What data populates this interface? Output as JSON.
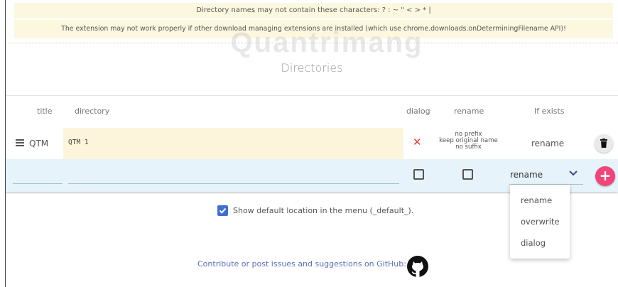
{
  "notices": {
    "line1": "Directory names may not contain these characters: ? : ~ \" < > * |",
    "line2": "The extension may not work properly if other download managing extensions are installed (which use chrome.downloads.onDeterminingFilename API)!"
  },
  "watermark": "Quantrimang",
  "section_title": "Directories",
  "table": {
    "headers": {
      "title": "title",
      "directory": "directory",
      "dialog": "dialog",
      "rename": "rename",
      "if_exists": "If exists"
    },
    "rows": [
      {
        "title": "QTM",
        "directory": "QTM 1",
        "dialog_mark": "✕",
        "rename_lines": [
          "no prefix",
          "keep original name",
          "no suffix"
        ],
        "if_exists": "rename"
      }
    ],
    "new_row": {
      "title_value": "",
      "directory_value": "",
      "dialog_checked": false,
      "rename_checked": false,
      "if_exists_selected": "rename",
      "add_label": "+"
    }
  },
  "dropdown": {
    "options": [
      "rename",
      "overwrite",
      "dialog"
    ]
  },
  "options": {
    "show_default_label": "Show default location in the menu (_default_).",
    "show_default_checked": true
  },
  "footer": {
    "contribute_text": "Contribute or post issues and suggestions on GitHub:"
  },
  "colors": {
    "notice_bg": "#fcf8df",
    "accent_pink": "#f0457a",
    "checkbox_blue": "#3f6fd2",
    "new_row_bg": "#e6f3fb",
    "delete_mark": "#e03b3b"
  }
}
